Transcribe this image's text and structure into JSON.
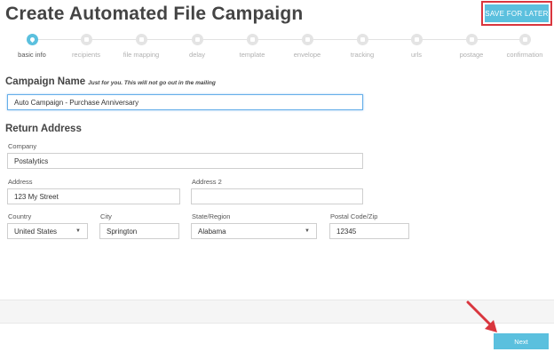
{
  "header": {
    "title": "Create Automated File Campaign",
    "save_label": "SAVE FOR LATER"
  },
  "steps": [
    {
      "label": "basic info",
      "icon": "drop-icon",
      "active": true
    },
    {
      "label": "recipients",
      "icon": "users-icon"
    },
    {
      "label": "file mapping",
      "icon": "file-icon"
    },
    {
      "label": "delay",
      "icon": "clock-icon"
    },
    {
      "label": "template",
      "icon": "template-icon"
    },
    {
      "label": "envelope",
      "icon": "envelope-icon"
    },
    {
      "label": "tracking",
      "icon": "target-icon"
    },
    {
      "label": "urls",
      "icon": "link-icon"
    },
    {
      "label": "postage",
      "icon": "stamp-icon"
    },
    {
      "label": "confirmation",
      "icon": "check-icon"
    }
  ],
  "campaign": {
    "heading": "Campaign Name",
    "hint": "Just for you. This will not go out in the mailing",
    "value": "Auto Campaign - Purchase Anniversary"
  },
  "return_address": {
    "heading": "Return Address",
    "company_label": "Company",
    "company_value": "Postalytics",
    "address_label": "Address",
    "address_value": "123 My Street",
    "address2_label": "Address 2",
    "address2_value": "",
    "country_label": "Country",
    "country_value": "United States",
    "city_label": "City",
    "city_value": "Springton",
    "state_label": "State/Region",
    "state_value": "Alabama",
    "zip_label": "Postal Code/Zip",
    "zip_value": "12345"
  },
  "footer": {
    "next_label": "Next"
  },
  "colors": {
    "accent": "#5bc0de",
    "highlight": "#d9363e"
  }
}
